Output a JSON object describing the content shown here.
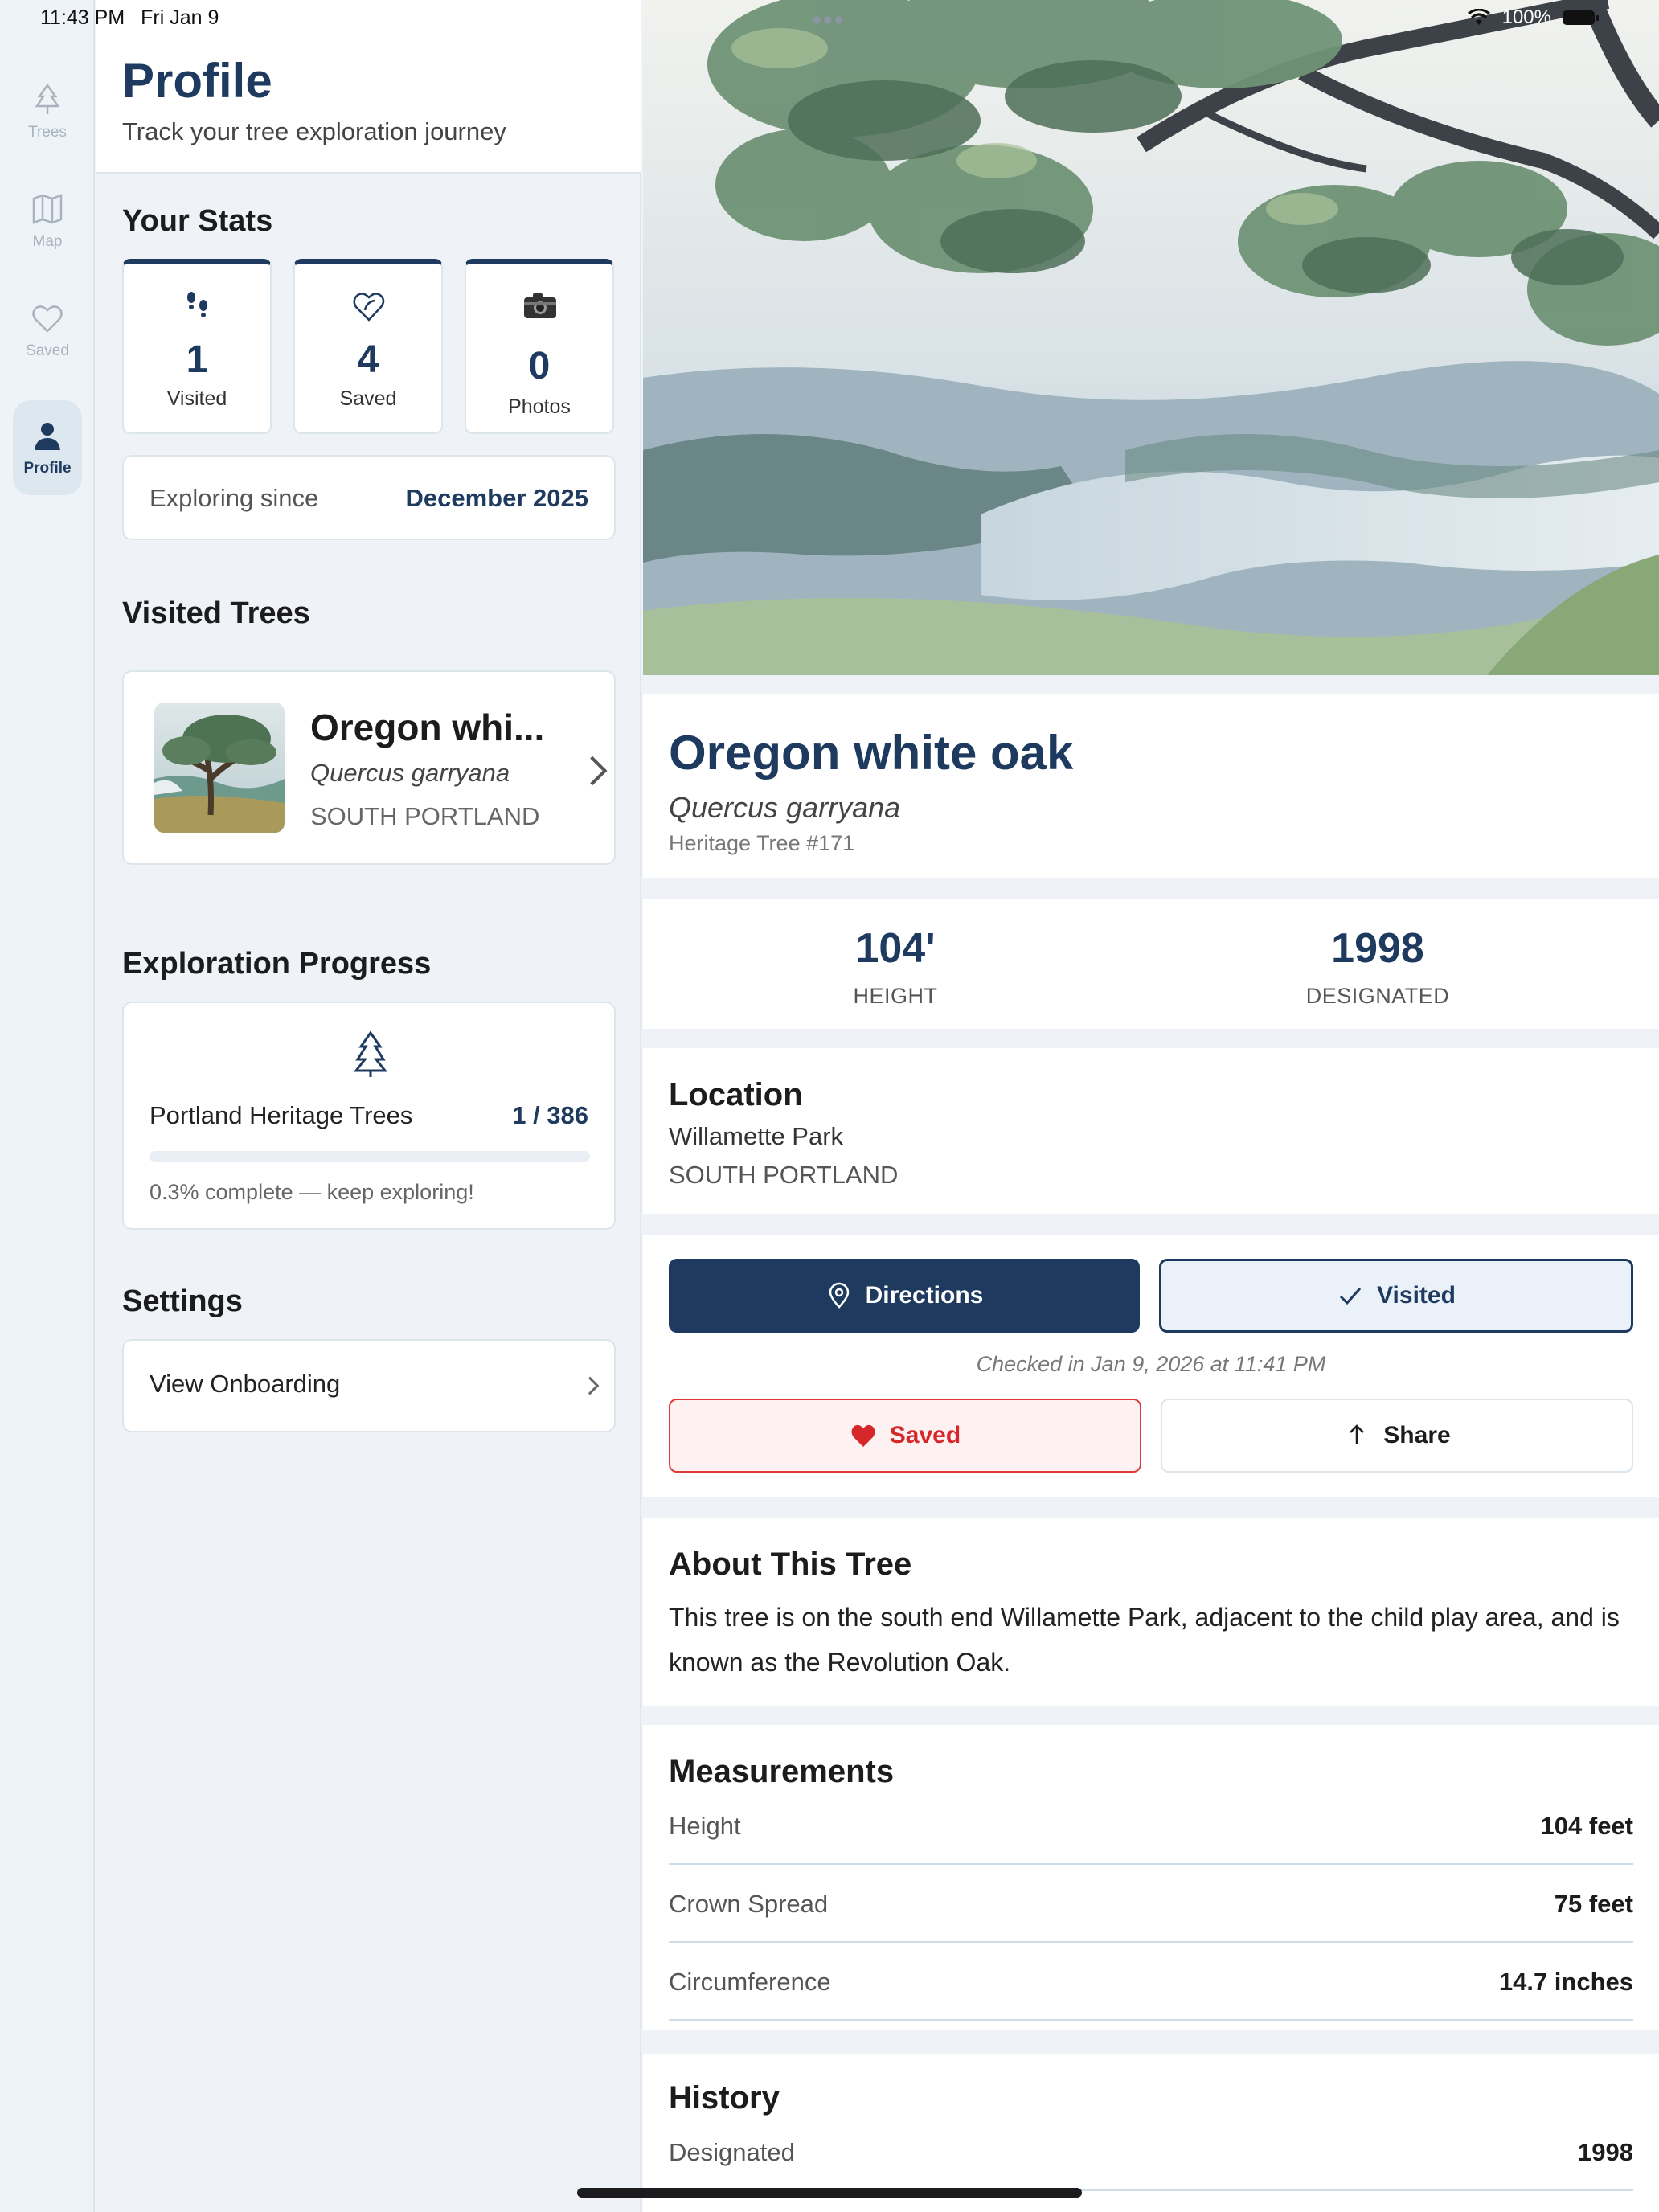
{
  "status_bar": {
    "time": "11:43 PM",
    "date": "Fri Jan 9",
    "battery": "100%"
  },
  "nav": {
    "items": [
      {
        "label": "Trees",
        "icon": "tree-icon",
        "active": false
      },
      {
        "label": "Map",
        "icon": "map-icon",
        "active": false
      },
      {
        "label": "Saved",
        "icon": "heart-icon",
        "active": false
      },
      {
        "label": "Profile",
        "icon": "person-icon",
        "active": true
      }
    ]
  },
  "profile": {
    "title": "Profile",
    "subtitle": "Track your tree exploration journey",
    "stats_title": "Your Stats",
    "stats": [
      {
        "value": "1",
        "label": "Visited",
        "icon": "footprints-icon"
      },
      {
        "value": "4",
        "label": "Saved",
        "icon": "heart-leaf-icon"
      },
      {
        "value": "0",
        "label": "Photos",
        "icon": "camera-icon"
      }
    ],
    "exploring_since_label": "Exploring since",
    "exploring_since_value": "December 2025",
    "visited_title": "Visited Trees",
    "visited_trees": [
      {
        "name": "Oregon whi...",
        "scientific": "Quercus garryana",
        "location": "SOUTH PORTLAND"
      }
    ],
    "progress_title": "Exploration Progress",
    "progress": {
      "label": "Portland Heritage Trees",
      "count": "1 / 386",
      "fraction": 0.0026,
      "note": "0.3% complete — keep exploring!"
    },
    "settings_title": "Settings",
    "settings_items": [
      {
        "label": "View Onboarding"
      }
    ]
  },
  "tree": {
    "name": "Oregon white oak",
    "scientific": "Quercus garryana",
    "heritage_id": "Heritage Tree #171",
    "metrics": [
      {
        "value": "104'",
        "label": "HEIGHT"
      },
      {
        "value": "1998",
        "label": "DESIGNATED"
      }
    ],
    "location_title": "Location",
    "park": "Willamette Park",
    "area": "SOUTH PORTLAND",
    "actions": {
      "directions": "Directions",
      "visited": "Visited",
      "checked_in": "Checked in Jan 9, 2026 at 11:41 PM",
      "saved": "Saved",
      "share": "Share"
    },
    "about_title": "About This Tree",
    "about_text": "This tree is on the south end Willamette Park, adjacent to the child play area, and is known as the Revolution Oak.",
    "measurements_title": "Measurements",
    "measurements": [
      {
        "label": "Height",
        "value": "104 feet"
      },
      {
        "label": "Crown Spread",
        "value": "75 feet"
      },
      {
        "label": "Circumference",
        "value": "14.7 inches"
      }
    ],
    "history_title": "History",
    "history": [
      {
        "label": "Designated",
        "value": "1998"
      }
    ]
  },
  "colors": {
    "primary": "#1f3a5f",
    "saved_red": "#e03a3a",
    "background": "#eff3f7"
  }
}
